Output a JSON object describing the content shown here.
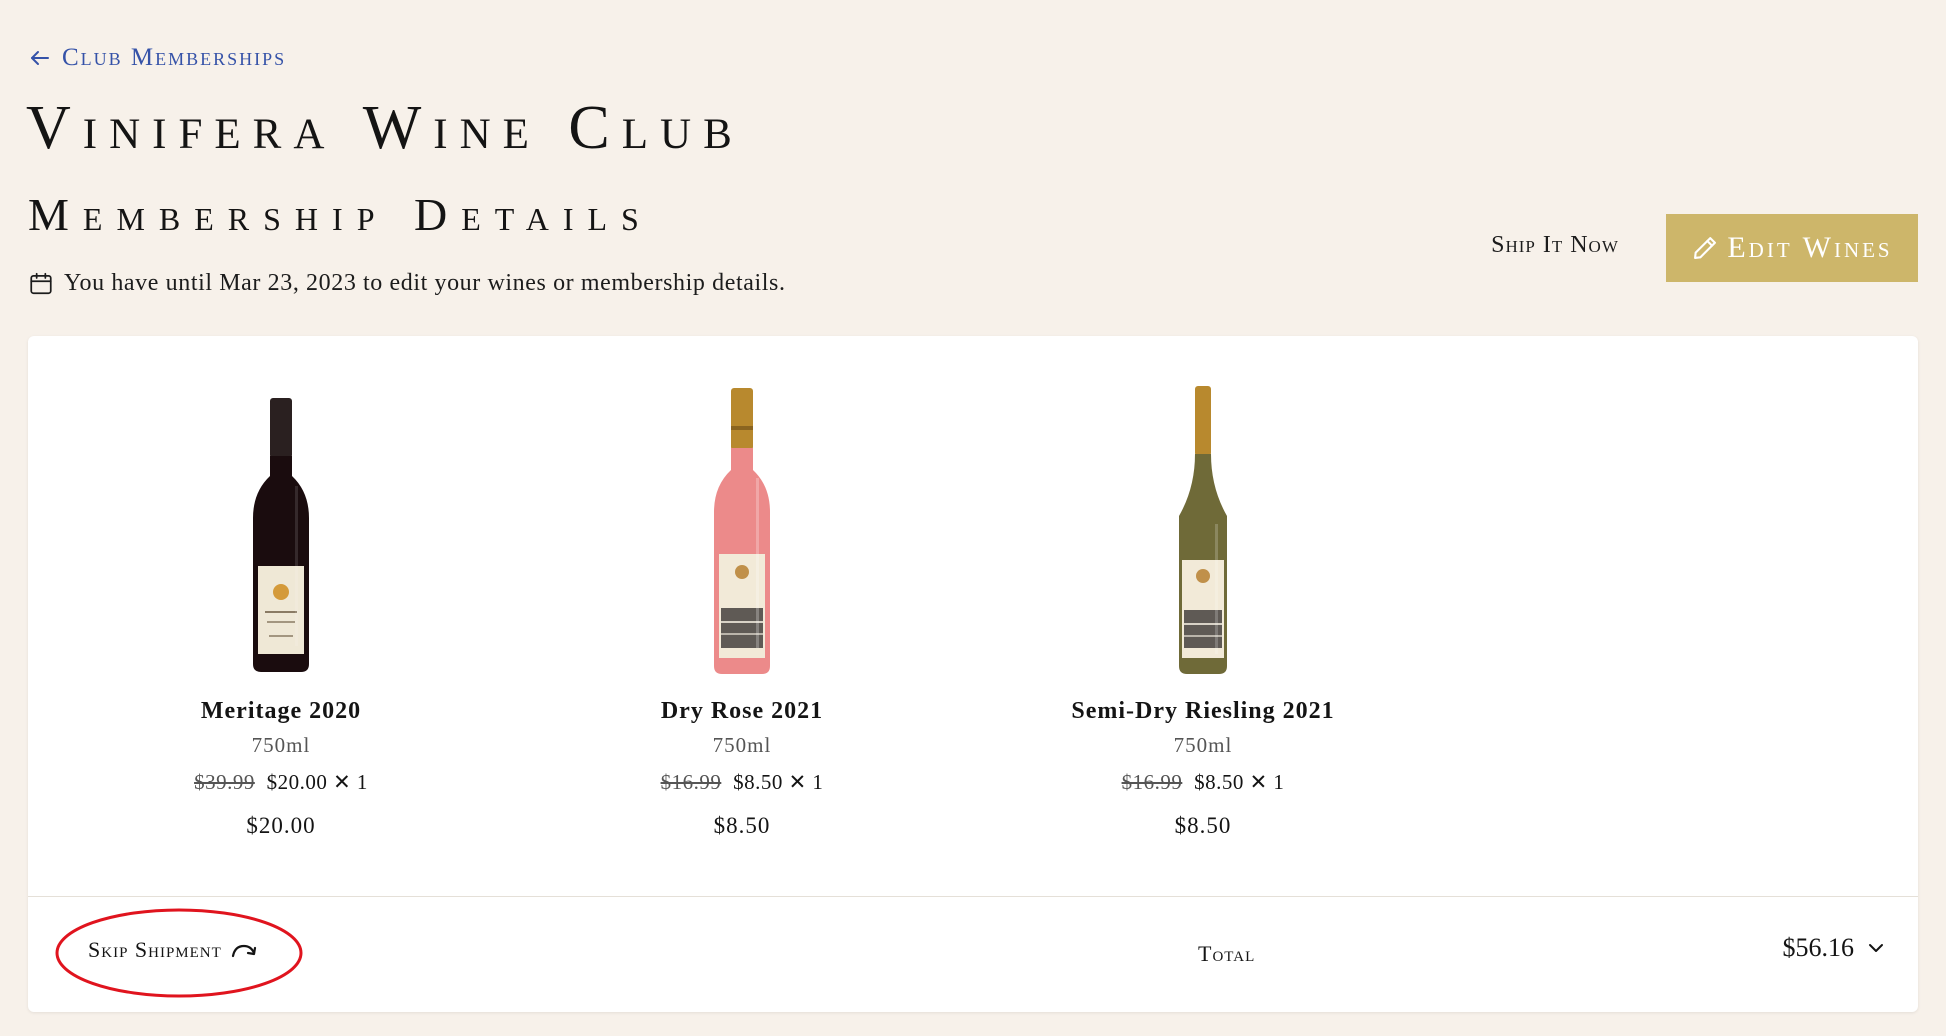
{
  "nav": {
    "back_label": "Club Memberships"
  },
  "header": {
    "club_name": "Vinifera Wine Club",
    "section_title": "Membership Details",
    "deadline_text": "You have until Mar 23, 2023 to edit your wines or membership details."
  },
  "actions": {
    "ship_now_label": "Ship It Now",
    "edit_wines_label": "Edit Wines"
  },
  "products": [
    {
      "name": "Meritage 2020",
      "size": "750ml",
      "original_price": "$39.99",
      "price": "$20.00",
      "quantity": "✕ 1",
      "subtotal": "$20.00",
      "bottle_icon": "red-wine-bottle",
      "bottle_color": "#1a0c0e",
      "capsule_color": "#2a2020",
      "label_color": "#efe8d6"
    },
    {
      "name": "Dry Rose 2021",
      "size": "750ml",
      "original_price": "$16.99",
      "price": "$8.50",
      "quantity": "✕ 1",
      "subtotal": "$8.50",
      "bottle_icon": "rose-wine-bottle",
      "bottle_color": "#ec8a8a",
      "capsule_color": "#b8892e",
      "label_color": "#f2ead8"
    },
    {
      "name": "Semi-Dry Riesling 2021",
      "size": "750ml",
      "original_price": "$16.99",
      "price": "$8.50",
      "quantity": "✕ 1",
      "subtotal": "$8.50",
      "bottle_icon": "white-wine-bottle",
      "bottle_color": "#6f6a38",
      "capsule_color": "#b8892e",
      "label_color": "#f2ead8"
    }
  ],
  "footer": {
    "skip_label": "Skip Shipment",
    "total_label": "Total",
    "total_value": "$56.16"
  },
  "colors": {
    "background": "#f7f1ea",
    "accent_gold": "#cdb66a",
    "link_blue": "#3552a8",
    "annotation_red": "#e0141e"
  }
}
